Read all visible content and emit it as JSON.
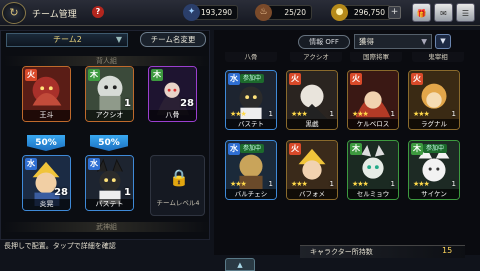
{
  "header": {
    "title": "チーム管理",
    "help": "?",
    "gems": "193,290",
    "stamina": "25/20",
    "gold": "296,750",
    "plus": "+",
    "menu_icons": [
      "present-icon",
      "mail-icon",
      "menu-icon"
    ]
  },
  "team": {
    "selected": "チーム2",
    "rename": "チーム名変更",
    "back_row_label": "背人組",
    "front_row_label": "武神組",
    "boost_a": "50%",
    "boost_b": "50%",
    "lock_label": "チームレベル4",
    "members": [
      {
        "name": "王斗",
        "element": "fire",
        "level": ""
      },
      {
        "name": "アクシオ",
        "element": "earth",
        "level": "1"
      },
      {
        "name": "八骨",
        "element": "earth",
        "level": "28"
      },
      {
        "name": "炎晃",
        "element": "water",
        "level": "28"
      },
      {
        "name": "バステト",
        "element": "water",
        "level": "1"
      }
    ]
  },
  "hint": "長押しで配置。タップで詳細を確認",
  "list": {
    "info_toggle": "情報 OFF",
    "sort": "獲得",
    "order": "▼",
    "partial_top": [
      "八骨",
      "アクシオ",
      "国際将軍",
      "鬼宰相"
    ],
    "cards": [
      {
        "name": "バステト",
        "tag": "参加中",
        "stars": "★★★",
        "num": "1"
      },
      {
        "name": "黒戯",
        "tag": "",
        "stars": "★★★",
        "num": "1"
      },
      {
        "name": "ケルベロス",
        "tag": "",
        "stars": "★★★",
        "num": "1"
      },
      {
        "name": "ラグナル",
        "tag": "",
        "stars": "★★★",
        "num": "1"
      },
      {
        "name": "バルチェシ",
        "tag": "参加中",
        "stars": "★★★",
        "num": "1"
      },
      {
        "name": "バフォメ",
        "tag": "",
        "stars": "★★★",
        "num": "1"
      },
      {
        "name": "セルミョウ",
        "tag": "",
        "stars": "★★★",
        "num": "1"
      },
      {
        "name": "サイケン",
        "tag": "参加中",
        "stars": "★★★",
        "num": "1"
      }
    ],
    "count_label": "キャラクター所持数",
    "count": "15"
  },
  "colors": {
    "accent": "#e8d27c",
    "boost": "#39a8f0",
    "count": "#ffd65c"
  }
}
